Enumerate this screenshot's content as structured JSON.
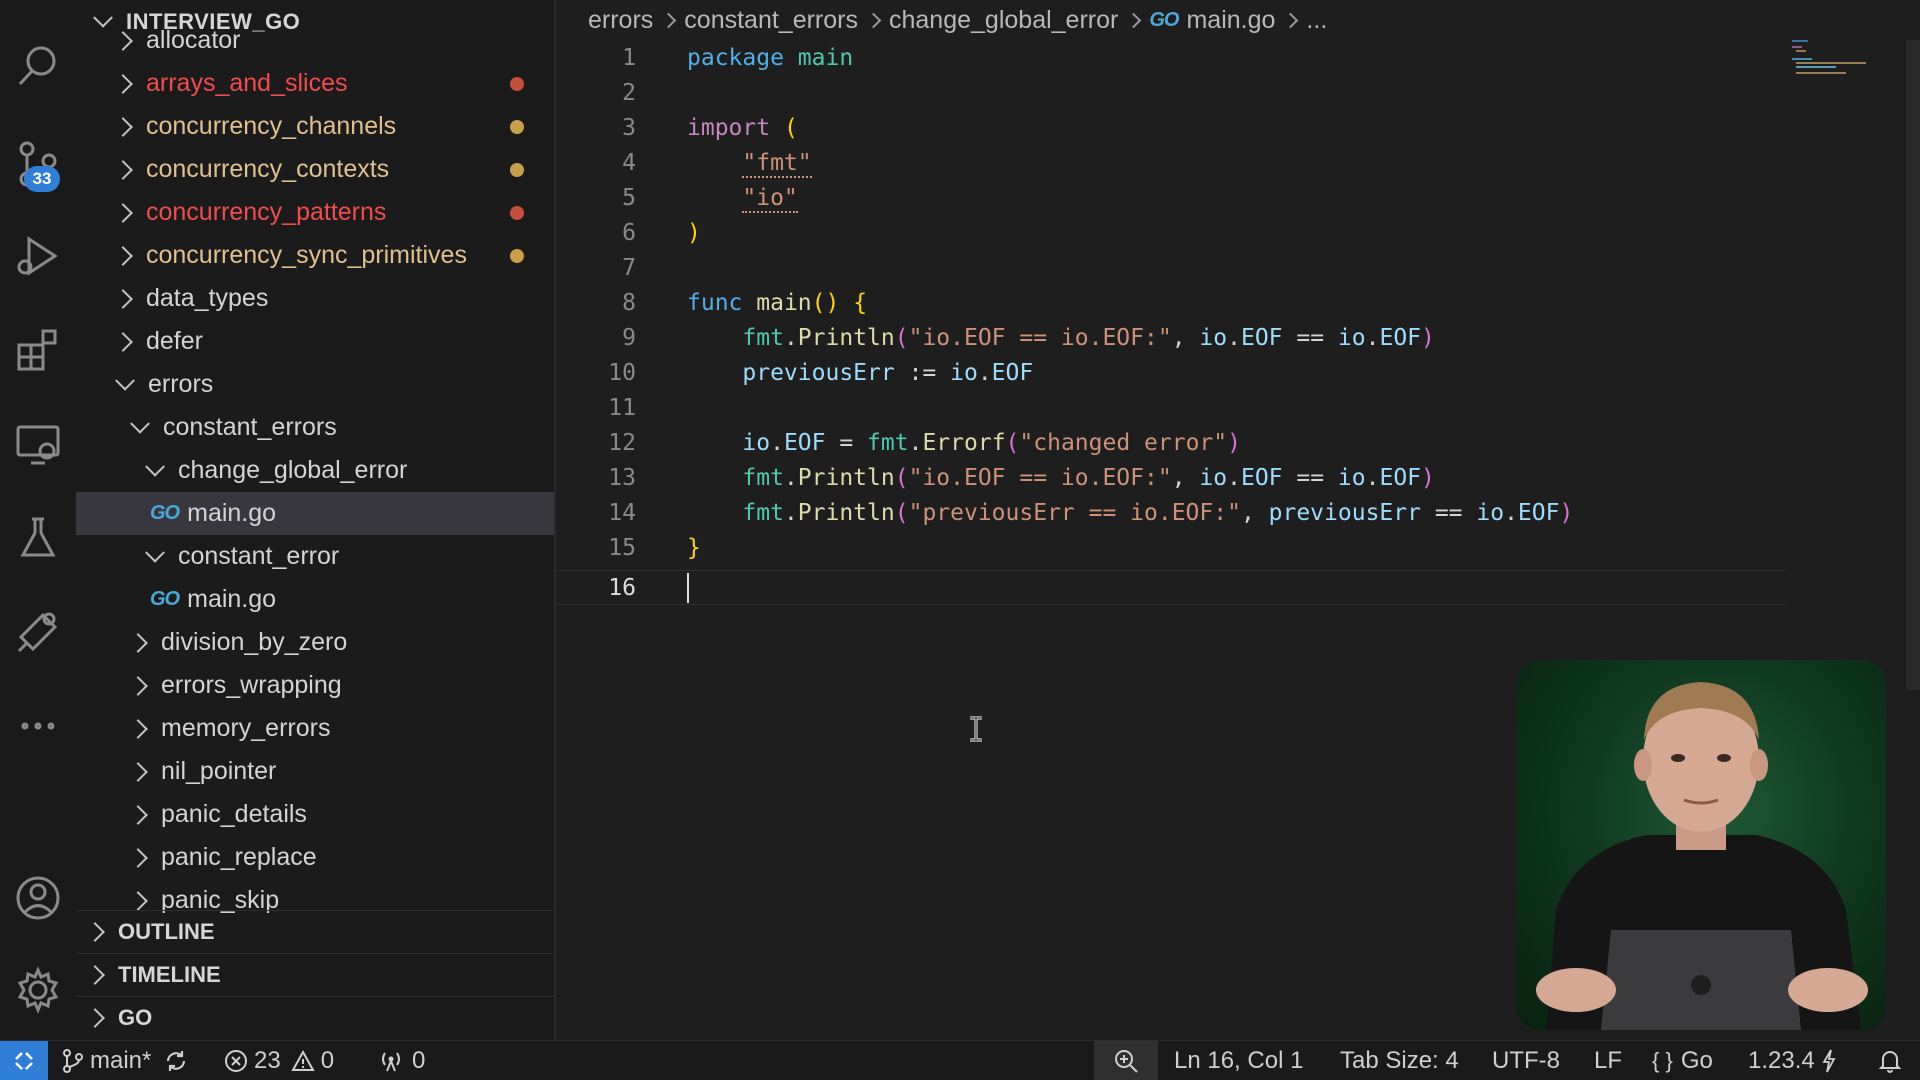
{
  "explorer": {
    "title": "INTERVIEW_GO",
    "items": [
      {
        "label": "allocator",
        "color": "#d4d4d4"
      },
      {
        "label": "arrays_and_slices",
        "color": "#f14c4c",
        "dot": "#c74e39"
      },
      {
        "label": "concurrency_channels",
        "color": "#e2c08d",
        "dot": "#c9a04a"
      },
      {
        "label": "concurrency_contexts",
        "color": "#e2c08d",
        "dot": "#c9a04a"
      },
      {
        "label": "concurrency_patterns",
        "color": "#f14c4c",
        "dot": "#c74e39"
      },
      {
        "label": "concurrency_sync_primitives",
        "color": "#e2c08d",
        "dot": "#c9a04a"
      },
      {
        "label": "data_types",
        "color": "#d4d4d4"
      },
      {
        "label": "defer",
        "color": "#d4d4d4"
      },
      {
        "label": "errors",
        "color": "#d4d4d4"
      },
      {
        "label": "constant_errors",
        "color": "#d4d4d4"
      },
      {
        "label": "change_global_error",
        "color": "#d4d4d4"
      },
      {
        "label": "main.go",
        "color": "#d4d4d4",
        "icon": "GO"
      },
      {
        "label": "constant_error",
        "color": "#d4d4d4"
      },
      {
        "label": "main.go",
        "color": "#d4d4d4",
        "icon": "GO"
      },
      {
        "label": "division_by_zero",
        "color": "#d4d4d4"
      },
      {
        "label": "errors_wrapping",
        "color": "#d4d4d4"
      },
      {
        "label": "memory_errors",
        "color": "#d4d4d4"
      },
      {
        "label": "nil_pointer",
        "color": "#d4d4d4"
      },
      {
        "label": "panic_details",
        "color": "#d4d4d4"
      },
      {
        "label": "panic_replace",
        "color": "#d4d4d4"
      },
      {
        "label": "panic_skip",
        "color": "#d4d4d4"
      }
    ],
    "sections": [
      "OUTLINE",
      "TIMELINE",
      "GO"
    ]
  },
  "activity": {
    "source_control_badge": "33",
    "icons": [
      "search-icon",
      "source-control-icon",
      "run-debug-icon",
      "extensions-icon",
      "remote-explorer-icon",
      "testing-icon",
      "go-test-icon",
      "more-icon",
      "account-icon",
      "settings-icon"
    ]
  },
  "breadcrumb": {
    "items": [
      "errors",
      "constant_errors",
      "change_global_error",
      "main.go",
      "..."
    ],
    "go_icon": "GO"
  },
  "code": {
    "line_numbers": [
      "1",
      "2",
      "3",
      "4",
      "5",
      "6",
      "7",
      "8",
      "9",
      "10",
      "11",
      "12",
      "13",
      "14",
      "15",
      "16"
    ],
    "tokens": {
      "package": "package",
      "main": "main",
      "import": "import",
      "fmt_str": "\"fmt\"",
      "io_str": "\"io\"",
      "func": "func",
      "main_fn": "main",
      "println": "Println",
      "errorf": "Errorf",
      "fmt": "fmt",
      "io": "io",
      "eof": "EOF",
      "previousErr": "previousErr",
      "str1": "\"io.EOF == io.EOF:\"",
      "str2": "\"changed error\"",
      "str3": "\"previousErr == io.EOF:\""
    }
  },
  "statusbar": {
    "branch": "main*",
    "errors": "23",
    "warnings": "0",
    "ports": "0",
    "position": "Ln 16, Col 1",
    "tab_size": "Tab Size: 4",
    "encoding": "UTF-8",
    "eol": "LF",
    "language": "Go",
    "go_version": "1.23.4"
  }
}
